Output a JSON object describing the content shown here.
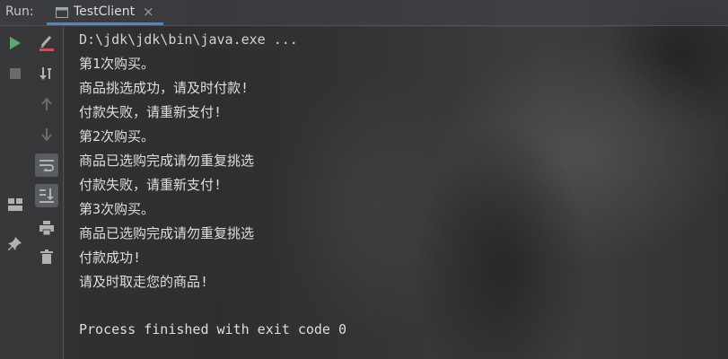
{
  "run_panel": {
    "label": "Run:",
    "tab": {
      "title": "TestClient",
      "close_glyph": "×",
      "icon": "console-window-icon"
    }
  },
  "toolbar_left": [
    {
      "icon": "run-play-icon",
      "color": "#59a869"
    },
    {
      "icon": "stop-square-icon",
      "color": "#6b6b6b"
    },
    {
      "icon": "layout-panels-icon",
      "color": "#afb1b3"
    },
    {
      "icon": "pin-icon",
      "color": "#afb1b3"
    }
  ],
  "toolbar_right": [
    {
      "icon": "wrench-edit-icon",
      "color": "#afb1b3"
    },
    {
      "icon": "sort-down-icon",
      "color": "#afb1b3"
    },
    {
      "icon": "arrow-up-icon",
      "color": "#6b6b6b"
    },
    {
      "icon": "arrow-down-icon",
      "color": "#6b6b6b"
    },
    {
      "icon": "soft-wrap-icon",
      "color": "#afb1b3",
      "pressed": true
    },
    {
      "icon": "scroll-to-end-icon",
      "color": "#afb1b3",
      "pressed": true
    },
    {
      "icon": "print-icon",
      "color": "#afb1b3"
    },
    {
      "icon": "trash-icon",
      "color": "#afb1b3"
    }
  ],
  "console": {
    "command": "D:\\jdk\\jdk\\bin\\java.exe ...",
    "lines": [
      "第1次购买。",
      "商品挑选成功，请及时付款!",
      "付款失败，请重新支付!",
      "第2次购买。",
      "商品已选购完成请勿重复挑选",
      "付款失败，请重新支付!",
      "第3次购买。",
      "商品已选购完成请勿重复挑选",
      "付款成功!",
      "请及时取走您的商品!"
    ],
    "exit_message": "Process finished with exit code 0"
  },
  "colors": {
    "tab_underline": "#4a88c7",
    "console_text": "#dedede"
  }
}
